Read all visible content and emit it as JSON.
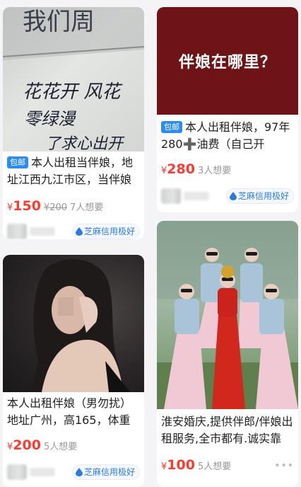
{
  "listings": [
    {
      "image_text": "我们周",
      "handwriting": [
        "花花开 风花",
        "零绿漫",
        "了求心出开"
      ],
      "badge": "包邮",
      "title": "本人出租当伴娘，地址江西九江市区，当伴娘",
      "price_symbol": "¥",
      "price": "150",
      "original_price": "¥200",
      "wants": "7人想要",
      "credit": "芝麻信用极好"
    },
    {
      "image_text": "伴娘在哪里？",
      "badge": "包邮",
      "title": "本人出租伴娘，97年 280➕油费（自己开",
      "price_symbol": "¥",
      "price": "280",
      "wants": "3人想要",
      "credit": "芝麻信用极好"
    },
    {
      "title": "本人出租伴娘（男勿扰）地址广州，高165，体重",
      "price_symbol": "¥",
      "price": "200",
      "wants": "5人想要",
      "credit": "芝麻信用极好"
    },
    {
      "title": "淮安婚庆,提供伴郎/伴娘出租服务,全市都有.诚实靠",
      "price_symbol": "¥",
      "price": "100",
      "wants": "5人想要",
      "more": "•••"
    }
  ],
  "colors": {
    "price": "#ff3a2e",
    "badge": "#2d8cf0",
    "credit": "#2d7be0",
    "banner_bg": "#6e1416"
  },
  "icons": [
    "sesame-credit-icon",
    "more-icon"
  ]
}
